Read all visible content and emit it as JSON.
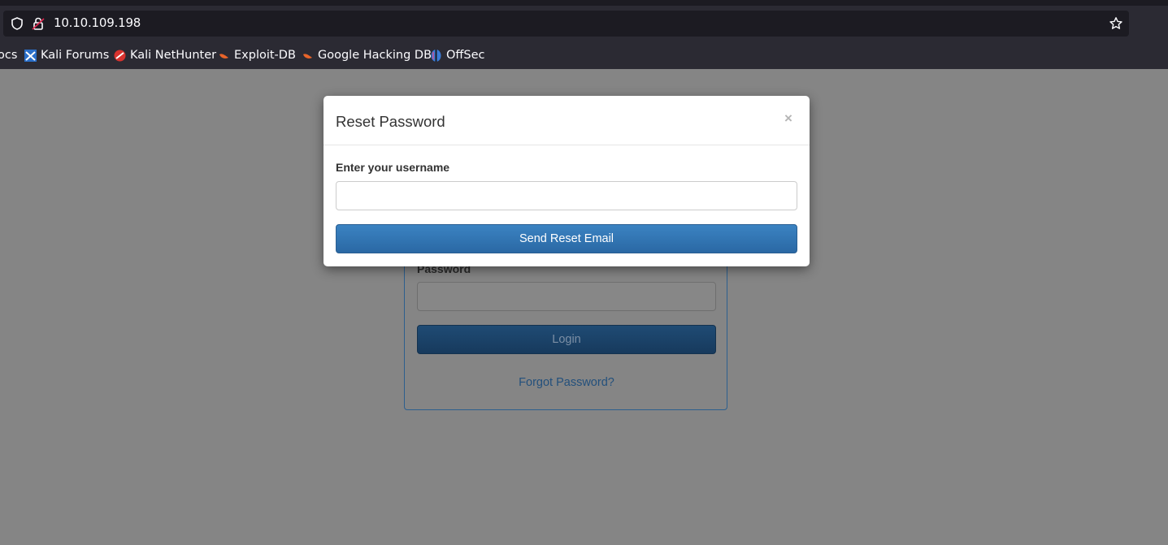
{
  "browser": {
    "url": "10.10.109.198",
    "bookmarks": [
      {
        "label": "ocs",
        "icon": "none"
      },
      {
        "label": "Kali Forums",
        "icon": "kali-forums-icon"
      },
      {
        "label": "Kali NetHunter",
        "icon": "kali-nethunter-icon"
      },
      {
        "label": "Exploit-DB",
        "icon": "exploit-db-icon"
      },
      {
        "label": "Google Hacking DB",
        "icon": "google-hacking-db-icon"
      },
      {
        "label": "OffSec",
        "icon": "offsec-icon"
      }
    ]
  },
  "login": {
    "password_label": "Password",
    "login_button": "Login",
    "forgot_link": "Forgot Password?"
  },
  "modal": {
    "title": "Reset Password",
    "close_symbol": "×",
    "username_label": "Enter your username",
    "username_value": "",
    "submit_button": "Send Reset Email"
  },
  "colors": {
    "overlay": "#858585",
    "chrome_bg": "#2b2a33",
    "urlbar_bg": "#1c1b22",
    "primary_button": "#337ab7",
    "link": "#23507c"
  }
}
